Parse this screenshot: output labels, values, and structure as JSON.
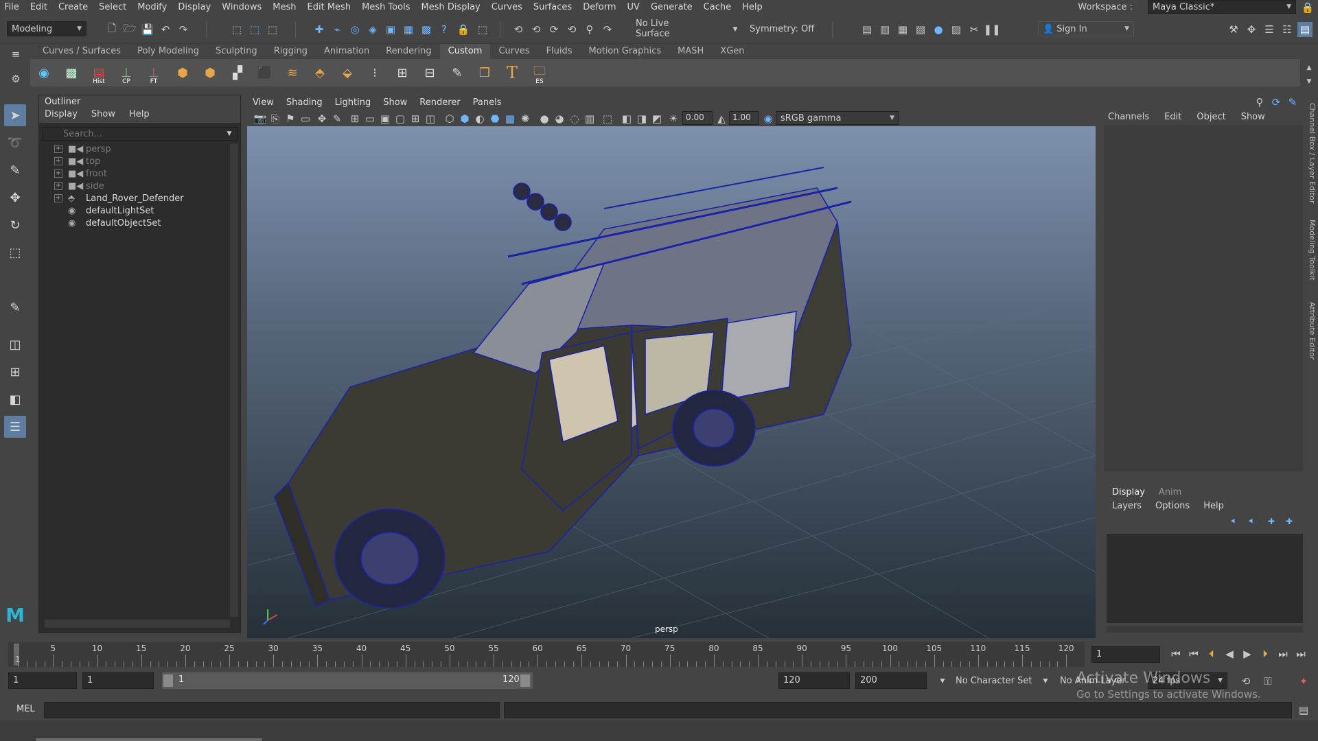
{
  "menubar": {
    "items": [
      "File",
      "Edit",
      "Create",
      "Select",
      "Modify",
      "Display",
      "Windows",
      "Mesh",
      "Edit Mesh",
      "Mesh Tools",
      "Mesh Display",
      "Curves",
      "Surfaces",
      "Deform",
      "UV",
      "Generate",
      "Cache",
      "Help"
    ],
    "workspace_label": "Workspace :",
    "workspace_value": "Maya Classic*"
  },
  "statusline": {
    "mode": "Modeling",
    "live_surface": "No Live Surface",
    "symmetry": "Symmetry: Off",
    "sign_in": "Sign In"
  },
  "shelf": {
    "tabs": [
      "Curves / Surfaces",
      "Poly Modeling",
      "Sculpting",
      "Rigging",
      "Animation",
      "Rendering",
      "Custom",
      "Curves",
      "Fluids",
      "Motion Graphics",
      "MASH",
      "XGen"
    ],
    "active_tab": "Custom",
    "icon_labels": {
      "hist": "Hist",
      "cp": "CP",
      "ft": "FT",
      "es": "ES"
    }
  },
  "outliner": {
    "title": "Outliner",
    "menu": [
      "Display",
      "Show",
      "Help"
    ],
    "search_placeholder": "Search...",
    "items": [
      {
        "label": "persp",
        "kind": "camera",
        "dim": true
      },
      {
        "label": "top",
        "kind": "camera",
        "dim": true
      },
      {
        "label": "front",
        "kind": "camera",
        "dim": true
      },
      {
        "label": "side",
        "kind": "camera",
        "dim": true
      },
      {
        "label": "Land_Rover_Defender",
        "kind": "mesh",
        "dim": false
      },
      {
        "label": "defaultLightSet",
        "kind": "set",
        "dim": false
      },
      {
        "label": "defaultObjectSet",
        "kind": "set",
        "dim": false
      }
    ]
  },
  "viewport": {
    "menu": [
      "View",
      "Shading",
      "Lighting",
      "Show",
      "Renderer",
      "Panels"
    ],
    "exposure": "0.00",
    "gamma": "1.00",
    "color_space": "sRGB gamma",
    "camera_label": "persp"
  },
  "channelbox": {
    "menu": [
      "Channels",
      "Edit",
      "Object",
      "Show"
    ],
    "side_tabs": [
      "Channel Box / Layer Editor",
      "Modeling Toolkit",
      "Attribute Editor"
    ]
  },
  "layer_editor": {
    "tabs": [
      "Display",
      "Anim"
    ],
    "active_tab": "Display",
    "menu": [
      "Layers",
      "Options",
      "Help"
    ]
  },
  "timeslider": {
    "ticks": [
      5,
      10,
      15,
      20,
      25,
      30,
      35,
      40,
      45,
      50,
      55,
      60,
      65,
      70,
      75,
      80,
      85,
      90,
      95,
      100,
      105,
      110,
      115,
      120
    ],
    "start_marker": "1",
    "current_frame": "1"
  },
  "range": {
    "start_frame": "1",
    "playback_start": "1",
    "range_min": "1",
    "range_max": "120",
    "playback_end": "120",
    "end_frame": "200",
    "character_set": "No Character Set",
    "anim_layer": "No Anim Layer",
    "fps": "24 fps"
  },
  "cmdline": {
    "label": "MEL"
  },
  "watermark": {
    "line1": "Activate Windows",
    "line2": "Go to Settings to activate Windows."
  }
}
